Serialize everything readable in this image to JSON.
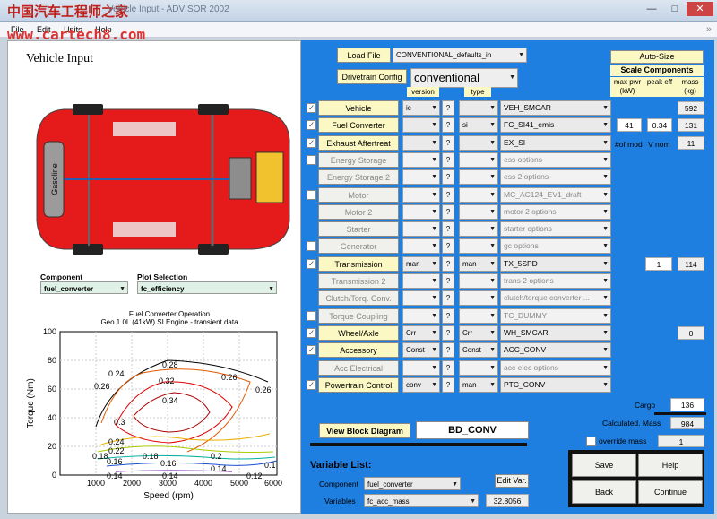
{
  "watermark": "中国汽车工程师之家",
  "watermark_url": "www.cartech8.com",
  "window": {
    "title": "Vehicle Input - ADVISOR 2002"
  },
  "menu": [
    "File",
    "Edit",
    "Units",
    "Help"
  ],
  "left": {
    "title": "Vehicle Input",
    "car_label": "Gasoline",
    "component_label": "Component",
    "component_value": "fuel_converter",
    "plot_label": "Plot Selection",
    "plot_value": "fc_efficiency",
    "chart_title": "Fuel Converter Operation",
    "chart_subtitle": "Geo 1.0L (41kW) SI Engine - transient data",
    "xlabel": "Speed (rpm)",
    "ylabel": "Torque (Nm)",
    "xticks": [
      "1000",
      "2000",
      "3000",
      "4000",
      "5000",
      "6000"
    ],
    "yticks": [
      "0",
      "20",
      "40",
      "60",
      "80",
      "100"
    ],
    "contour_labels": [
      "0.28",
      "0.24",
      "0.26",
      "0.32",
      "0.26",
      "0.26",
      "0.34",
      "0.3",
      "0.24",
      "0.22",
      "0.18",
      "0.18",
      "0.16",
      "0.2",
      "0.16",
      "0.14",
      "0.14",
      "0.14",
      "0.12",
      "0.1"
    ]
  },
  "right": {
    "load_file": "Load File",
    "load_value": "CONVENTIONAL_defaults_in",
    "drivetrain_cfg": "Drivetrain Config",
    "drivetrain_value": "conventional",
    "version_hdr": "version",
    "type_hdr": "type",
    "autosize": "Auto-Size",
    "scale_hdr": "Scale Components",
    "col1": "max pwr\n(kW)",
    "col2": "peak eff",
    "col3": "mass\n(kg)",
    "nofmod": "#of mod",
    "vnom": "V nom",
    "rows": [
      {
        "label": "Vehicle",
        "checked": true,
        "enabled": true,
        "ver": "ic",
        "q": "?",
        "type": "",
        "comp": "VEH_SMCAR",
        "mass": "592"
      },
      {
        "label": "Fuel Converter",
        "checked": true,
        "enabled": true,
        "ver": "",
        "q": "?",
        "type": "si",
        "comp": "FC_SI41_emis",
        "pwr": "41",
        "eff": "0.34",
        "mass": "131"
      },
      {
        "label": "Exhaust Aftertreat",
        "checked": true,
        "enabled": true,
        "ver": "",
        "q": "?",
        "type": "",
        "comp": "EX_SI",
        "mass": "11"
      },
      {
        "label": "Energy Storage",
        "checked": false,
        "enabled": false,
        "ver": "",
        "q": "?",
        "type": "",
        "comp": "ess options"
      },
      {
        "label": "Energy Storage 2",
        "checked": false,
        "enabled": false,
        "ver": "",
        "q": "?",
        "type": "",
        "comp": "ess 2 options"
      },
      {
        "label": "Motor",
        "checked": false,
        "enabled": false,
        "ver": "",
        "q": "?",
        "type": "",
        "comp": "MC_AC124_EV1_draft"
      },
      {
        "label": "Motor 2",
        "checked": false,
        "enabled": false,
        "ver": "",
        "q": "?",
        "type": "",
        "comp": "motor 2 options"
      },
      {
        "label": "Starter",
        "checked": false,
        "enabled": false,
        "ver": "",
        "q": "?",
        "type": "",
        "comp": "starter options"
      },
      {
        "label": "Generator",
        "checked": false,
        "enabled": false,
        "ver": "",
        "q": "?",
        "type": "",
        "comp": " gc options"
      },
      {
        "label": "Transmission",
        "checked": true,
        "enabled": true,
        "ver": "man",
        "q": "?",
        "type": "man",
        "comp": "TX_5SPD",
        "pwr": "1",
        "mass": "114"
      },
      {
        "label": "Transmission 2",
        "checked": false,
        "enabled": false,
        "ver": "",
        "q": "?",
        "type": "",
        "comp": "trans 2 options"
      },
      {
        "label": "Clutch/Torq. Conv.",
        "checked": false,
        "enabled": false,
        "ver": "",
        "q": "?",
        "type": "",
        "comp": "clutch/torque converter ..."
      },
      {
        "label": "Torque Coupling",
        "checked": false,
        "enabled": false,
        "ver": "",
        "q": "?",
        "type": "",
        "comp": "TC_DUMMY"
      },
      {
        "label": "Wheel/Axle",
        "checked": true,
        "enabled": true,
        "ver": "Crr",
        "q": "?",
        "type": "Crr",
        "comp": "WH_SMCAR",
        "mass": "0"
      },
      {
        "label": "Accessory",
        "checked": true,
        "enabled": true,
        "ver": "Const",
        "q": "?",
        "type": "Const",
        "comp": "ACC_CONV"
      },
      {
        "label": "Acc Electrical",
        "checked": false,
        "enabled": false,
        "ver": "",
        "q": "?",
        "type": "",
        "comp": "acc elec options"
      },
      {
        "label": "Powertrain Control",
        "checked": true,
        "enabled": true,
        "ver": "conv",
        "q": "?",
        "type": "man",
        "comp": "PTC_CONV"
      }
    ],
    "cargo_label": "Cargo",
    "cargo_value": "136",
    "calc_mass_label": "Calculated. Mass",
    "calc_mass_value": "984",
    "override_label": "override mass",
    "override_value": "1",
    "view_block": "View Block Diagram",
    "block_name": "BD_CONV",
    "var_list": "Variable List:",
    "comp_label": "Component",
    "comp_value": "fuel_converter",
    "vars_label": "Variables",
    "vars_value": "fc_acc_mass",
    "var_result": "32.8056",
    "edit_var": "Edit Var.",
    "save": "Save",
    "help": "Help",
    "back": "Back",
    "cont": "Continue"
  }
}
